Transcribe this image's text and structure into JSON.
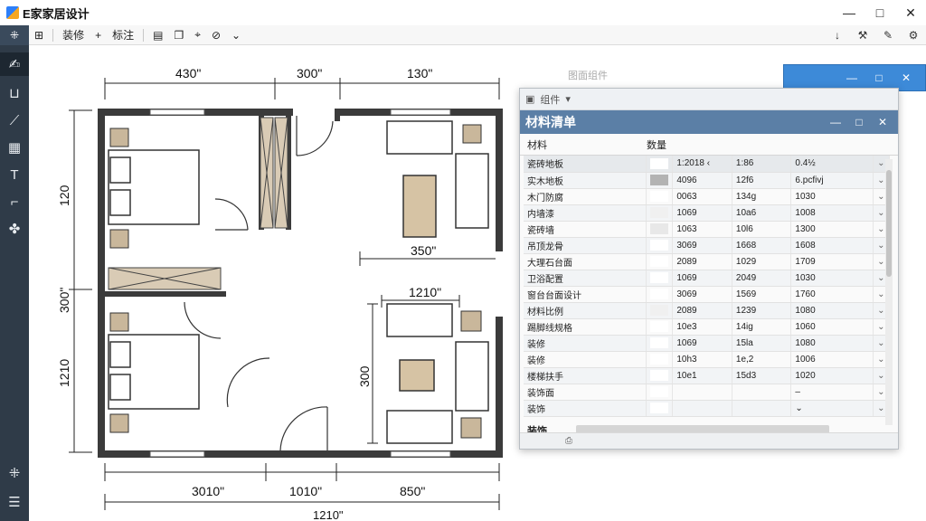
{
  "app": {
    "title": "E家家居设计"
  },
  "window_controls": {
    "minimize": "—",
    "maximize": "□",
    "close": "✕"
  },
  "toolbar": {
    "items": [
      {
        "label": "装修"
      },
      {
        "label": "+"
      },
      {
        "label": "标注"
      }
    ]
  },
  "plan": {
    "dims": {
      "top_1": "430\"",
      "top_2": "300\"",
      "top_3": "130\"",
      "left_1": "120",
      "left_2": "300\"",
      "left_3": "1210",
      "mid_1": "350\"",
      "mid_2": "1210\"",
      "mid_v": "300",
      "bottom_1": "3010\"",
      "bottom_2": "1010\"",
      "bottom_3": "850\"",
      "bottom_total": "1210\""
    }
  },
  "materials_window": {
    "ghost_text": "图面组件",
    "top_label": "组件",
    "title": "材料清单",
    "controls": {
      "minimize": "—",
      "maximize": "□",
      "close": "✕"
    },
    "columns": {
      "material": "材料",
      "quantity": "数量"
    },
    "rows": [
      {
        "name": "瓷砖地板",
        "swatch": "#ffffff",
        "q1": "1:2018 ‹",
        "q2": "1:86",
        "q3": "0.4½",
        "mark": "⌄"
      },
      {
        "name": "实木地板",
        "swatch": "#b3b3b3",
        "q1": "4096",
        "q2": "12f6",
        "q3": "6.pcfivj",
        "mark": "⌄"
      },
      {
        "name": "木门防腐",
        "swatch": "#ffffff",
        "q1": "0063",
        "q2": "134g",
        "q3": "1030",
        "mark": "⌄"
      },
      {
        "name": "内墙漆",
        "swatch": "#f0f0f0",
        "q1": "1069",
        "q2": "10a6",
        "q3": "1008",
        "mark": "⌄"
      },
      {
        "name": "瓷砖墙",
        "swatch": "#e8e8e8",
        "q1": "1063",
        "q2": "10l6",
        "q3": "1300",
        "mark": "⌄"
      },
      {
        "name": "吊顶龙骨",
        "swatch": "#ffffff",
        "q1": "3069",
        "q2": "1668",
        "q3": "1608",
        "mark": "⌄"
      },
      {
        "name": "大理石台面",
        "swatch": "#ffffff",
        "q1": "2089",
        "q2": "1029",
        "q3": "1709",
        "mark": "⌄"
      },
      {
        "name": "卫浴配置",
        "swatch": "#ffffff",
        "q1": "1069",
        "q2": "2049",
        "q3": "1030",
        "mark": "⌄"
      },
      {
        "name": "窗台台面设计",
        "swatch": "#ffffff",
        "q1": "3069",
        "q2": "1569",
        "q3": "1760",
        "mark": "⌄"
      },
      {
        "name": "材料比例",
        "swatch": "#f0f0f0",
        "q1": "2089",
        "q2": "1239",
        "q3": "1080",
        "mark": "⌄"
      },
      {
        "name": "踢脚线规格",
        "swatch": "#ffffff",
        "q1": "10e3",
        "q2": "14ig",
        "q3": "1060",
        "mark": "⌄"
      },
      {
        "name": "装修",
        "swatch": "#ffffff",
        "q1": "1069",
        "q2": "15la",
        "q3": "1080",
        "mark": "⌄"
      },
      {
        "name": "装修",
        "swatch": "#ffffff",
        "q1": "10h3",
        "q2": "1e,2",
        "q3": "1006",
        "mark": "⌄"
      },
      {
        "name": "楼梯扶手",
        "swatch": "#ffffff",
        "q1": "10e1",
        "q2": "15d3",
        "q3": "1020",
        "mark": "⌄"
      },
      {
        "name": "装饰面",
        "swatch": "#ffffff",
        "q1": "",
        "q2": "",
        "q3": "–",
        "mark": "⌄"
      },
      {
        "name": "装饰",
        "swatch": "#ffffff",
        "q1": "",
        "q2": "",
        "q3": "⌄",
        "mark": "⌄"
      }
    ],
    "footer_label": "装饰"
  }
}
